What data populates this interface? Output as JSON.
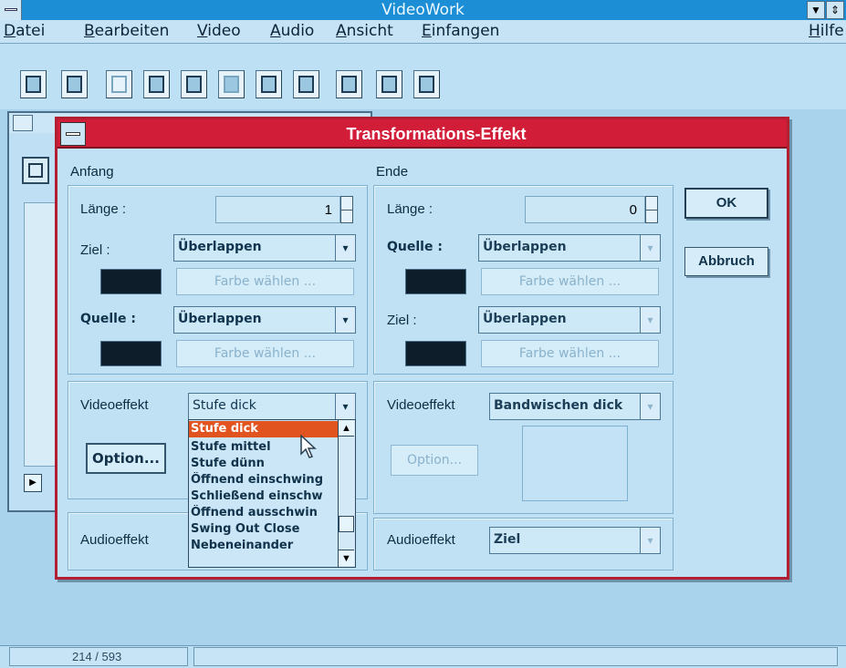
{
  "app": {
    "title": "VideoWork"
  },
  "menu": {
    "items": [
      "Datei",
      "Bearbeiten",
      "Video",
      "Audio",
      "Ansicht",
      "Einfangen"
    ],
    "help": "Hilfe"
  },
  "status": {
    "position": "214 / 593"
  },
  "dialog": {
    "title": "Transformations-Effekt",
    "ok_label": "OK",
    "cancel_label": "Abbruch",
    "start": {
      "heading": "Anfang",
      "length_label": "Länge :",
      "length_value": "1",
      "target_label": "Ziel :",
      "target_value": "Überlappen",
      "target_color_button": "Farbe wählen ...",
      "source_label": "Quelle :",
      "source_value": "Überlappen",
      "source_color_button": "Farbe wählen ...",
      "video_effect_label": "Videoeffekt",
      "video_effect_value": "Stufe dick",
      "option_button": "Option...",
      "audio_effect_label": "Audioeffekt"
    },
    "end": {
      "heading": "Ende",
      "length_label": "Länge :",
      "length_value": "0",
      "source_label": "Quelle :",
      "source_value": "Überlappen",
      "source_color_button": "Farbe wählen ...",
      "target_label": "Ziel :",
      "target_value": "Überlappen",
      "target_color_button": "Farbe wählen ...",
      "video_effect_label": "Videoeffekt",
      "video_effect_value": "Bandwischen dick",
      "option_button": "Option...",
      "audio_effect_label": "Audioeffekt",
      "audio_effect_value": "Ziel"
    },
    "video_effect_list": {
      "items": [
        "Stufe dick",
        "Stufe mittel",
        "Stufe dünn",
        "Öffnend einschwing",
        "Schließend einschw",
        "Öffnend ausschwin",
        "Swing Out Close",
        "Nebeneinander"
      ],
      "selected_index": 0
    }
  },
  "colors": {
    "dialog_title_bar": "#d21d38",
    "app_title_bar": "#1b8ed6",
    "selection": "#e2541f",
    "swatch": "#0d1e2a"
  }
}
